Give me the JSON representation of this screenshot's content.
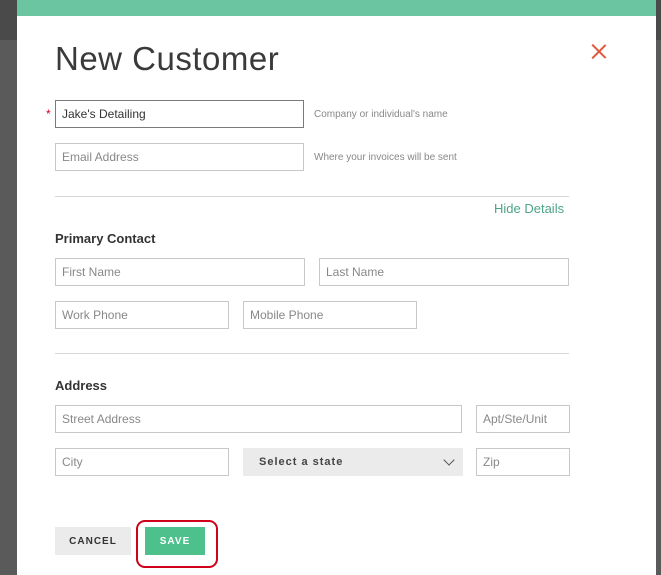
{
  "dialog": {
    "title": "New Customer",
    "required_mark": "*"
  },
  "customer": {
    "name_value": "Jake's Detailing",
    "name_hint": "Company or individual's name",
    "email_placeholder": "Email Address",
    "email_hint": "Where your invoices will be sent"
  },
  "details_toggle": "Hide Details",
  "primary_contact": {
    "heading": "Primary Contact",
    "first_name_placeholder": "First Name",
    "last_name_placeholder": "Last Name",
    "work_phone_placeholder": "Work Phone",
    "mobile_phone_placeholder": "Mobile Phone"
  },
  "address": {
    "heading": "Address",
    "street_placeholder": "Street Address",
    "unit_placeholder": "Apt/Ste/Unit",
    "city_placeholder": "City",
    "state_selected": "Select a state",
    "zip_placeholder": "Zip"
  },
  "actions": {
    "cancel_label": "CANCEL",
    "save_label": "SAVE"
  },
  "colors": {
    "accent": "#6cc5a1",
    "save": "#4dc08c",
    "link": "#4da486",
    "close": "#e0593d",
    "highlight": "#d0021b"
  }
}
